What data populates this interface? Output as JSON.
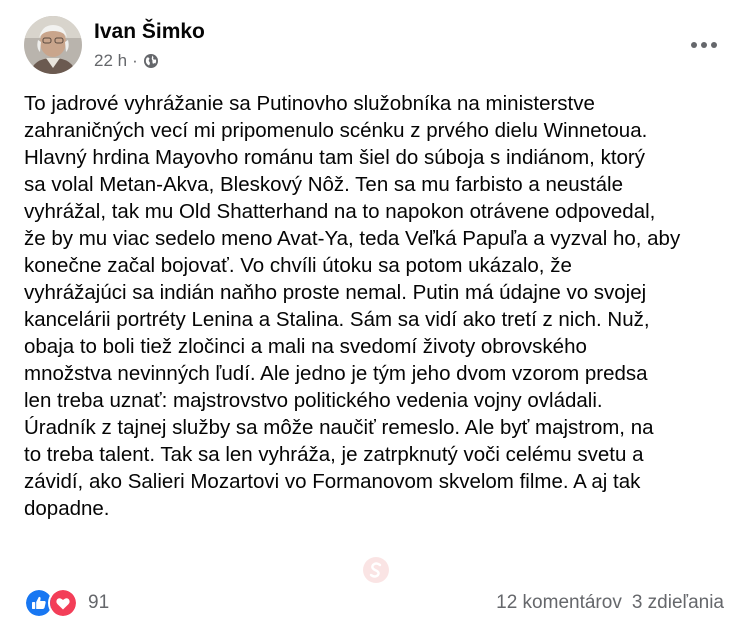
{
  "post": {
    "author": "Ivan Šimko",
    "timestamp": "22 h",
    "separator": "·",
    "privacy_icon": "globe-icon",
    "more_icon": "more-horizontal-icon",
    "text": "To jadrové vyhrážanie sa Putinovho služobníka na ministerstve\nzahraničných vecí mi pripomenulo scénku z prvého dielu Winnetoua.\nHlavný hrdina Mayovho románu tam šiel do súboja s indiánom, ktorý\nsa volal Metan-Akva, Bleskový Nôž. Ten sa mu farbisto a neustále\nvyhrážal, tak mu Old Shatterhand na to napokon otrávene odpovedal,\nže by mu viac sedelo meno Avat-Ya, teda Veľká Papuľa a vyzval ho, aby\nkonečne začal bojovať. Vo chvíli útoku sa potom ukázalo, že\nvyhrážajúci sa indián naňho proste nemal. Putin má údajne vo svojej\nkancelárii portréty Lenina a Stalina. Sám sa vidí ako tretí z nich. Nuž,\nobaja to boli tiež zločinci a mali na svedomí životy obrovského\nmnožstva nevinných ľudí. Ale jedno je tým jeho dvom vzorom predsa\nlen treba uznať: majstrovstvo politického vedenia vojny ovládali.\nÚradník z tajnej služby sa môže naučiť remeslo. Ale byť majstrom, na\nto treba talent. Tak sa len vyhráža, je zatrpknutý voči celému svetu a\nzávidí, ako Salieri Mozartovi vo Formanovom skvelom filme. A aj tak\ndopadne."
  },
  "reactions": {
    "icons": [
      "like-icon",
      "love-icon"
    ],
    "count": "91"
  },
  "stats": {
    "comments": "12 komentárov",
    "shares": "3 zdieľania"
  },
  "colors": {
    "like_blue": "#1877f2",
    "love_red": "#f33e58",
    "secondary_text": "#65676b",
    "primary_text": "#050505"
  }
}
